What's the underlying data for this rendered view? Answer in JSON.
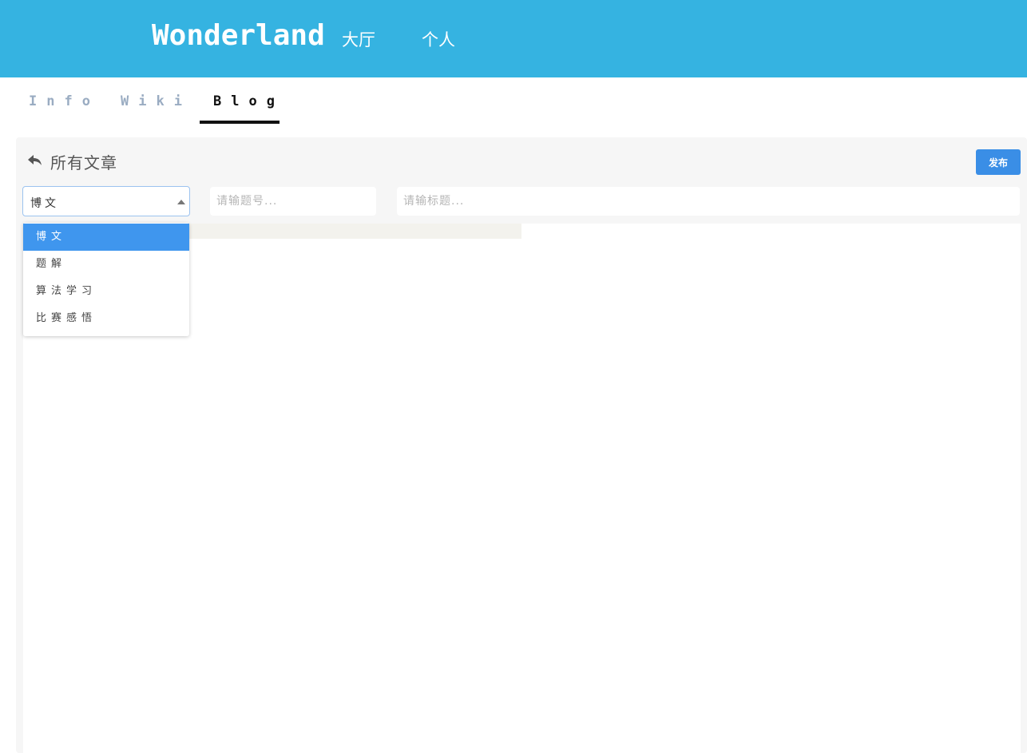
{
  "header": {
    "brand": "Wonderland",
    "nav": {
      "hall": "大厅",
      "personal": "个人"
    }
  },
  "tabs": [
    {
      "label": "Info",
      "active": false
    },
    {
      "label": "Wiki",
      "active": false
    },
    {
      "label": "Blog",
      "active": true
    }
  ],
  "panel": {
    "title": "所有文章",
    "back_icon": "reply-arrow-icon",
    "publish_label": "发布"
  },
  "filters": {
    "category_selected": "博文",
    "problem_placeholder": "请输题号...",
    "title_placeholder": "请输标题...",
    "options": [
      "博文",
      "题解",
      "算法学习",
      "比赛感悟"
    ]
  },
  "colors": {
    "header_bg": "#35b3e1",
    "accent": "#3a8ee6",
    "selected_option": "#3f96ee",
    "active_tab": "#111111",
    "inactive_tab": "#9aacc2"
  }
}
